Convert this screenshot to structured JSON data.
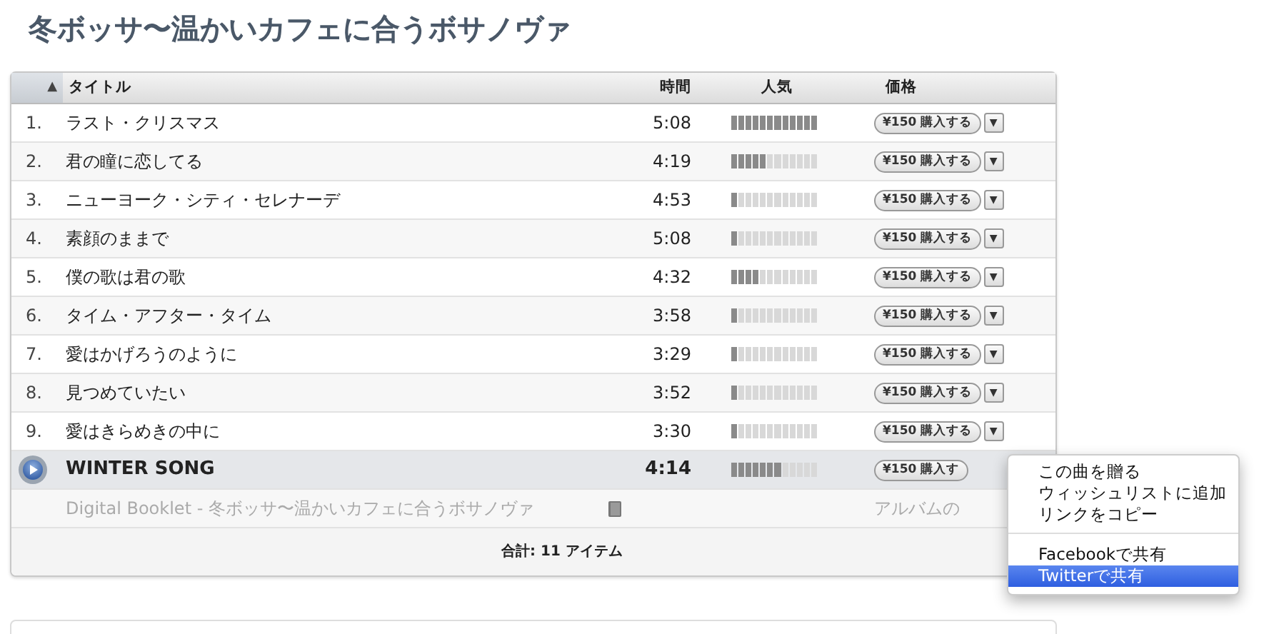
{
  "title": "冬ボッサ〜温かいカフェに合うボサノヴァ",
  "table": {
    "sort_arrow": "▲",
    "columns": [
      "タイトル",
      "時間",
      "人気",
      "価格"
    ],
    "rows": [
      {
        "kind": "track",
        "number": "1.",
        "title": "ラスト・クリスマス",
        "time": "5:08",
        "level": 1.0,
        "price": "¥150 購入する",
        "menu_arrow": "▼"
      },
      {
        "kind": "track",
        "number": "2.",
        "title": "君の瞳に恋してる",
        "time": "4:19",
        "level": 0.42,
        "price": "¥150 購入する",
        "menu_arrow": "▼"
      },
      {
        "kind": "track",
        "number": "3.",
        "title": "ニューヨーク・シティ・セレナーデ",
        "time": "4:53",
        "level": 0.08,
        "price": "¥150 購入する",
        "menu_arrow": "▼"
      },
      {
        "kind": "track",
        "number": "4.",
        "title": "素顔のままで",
        "time": "5:08",
        "level": 0.08,
        "price": "¥150 購入する",
        "menu_arrow": "▼"
      },
      {
        "kind": "track",
        "number": "5.",
        "title": "僕の歌は君の歌",
        "time": "4:32",
        "level": 0.33,
        "price": "¥150 購入する",
        "menu_arrow": "▼"
      },
      {
        "kind": "track",
        "number": "6.",
        "title": "タイム・アフター・タイム",
        "time": "3:58",
        "level": 0.08,
        "price": "¥150 購入する",
        "menu_arrow": "▼"
      },
      {
        "kind": "track",
        "number": "7.",
        "title": "愛はかげろうのように",
        "time": "3:29",
        "level": 0.08,
        "price": "¥150 購入する",
        "menu_arrow": "▼"
      },
      {
        "kind": "track",
        "number": "8.",
        "title": "見つめていたい",
        "time": "3:52",
        "level": 0.08,
        "price": "¥150 購入する",
        "menu_arrow": "▼"
      },
      {
        "kind": "track",
        "number": "9.",
        "title": "愛はきらめきの中に",
        "time": "3:30",
        "level": 0.08,
        "price": "¥150 購入する",
        "menu_arrow": "▼"
      },
      {
        "kind": "playing",
        "title": "WINTER SONG",
        "time": "4:14",
        "level": 0.58,
        "price": "¥150 購入す"
      },
      {
        "kind": "booklet",
        "title": "Digital Booklet - 冬ボッサ〜温かいカフェに合うボサノヴァ",
        "price": "アルバムの"
      }
    ],
    "total": "合計: 11 アイテム"
  },
  "context_menu": {
    "items": [
      {
        "kind": "item",
        "label": "この曲を贈る",
        "selected": false
      },
      {
        "kind": "item",
        "label": "ウィッシュリストに追加",
        "selected": false
      },
      {
        "kind": "item",
        "label": "リンクをコピー",
        "selected": false
      },
      {
        "kind": "separator"
      },
      {
        "kind": "item",
        "label": "Facebookで共有",
        "selected": false
      },
      {
        "kind": "item",
        "label": "Twitterで共有",
        "selected": true
      }
    ]
  }
}
